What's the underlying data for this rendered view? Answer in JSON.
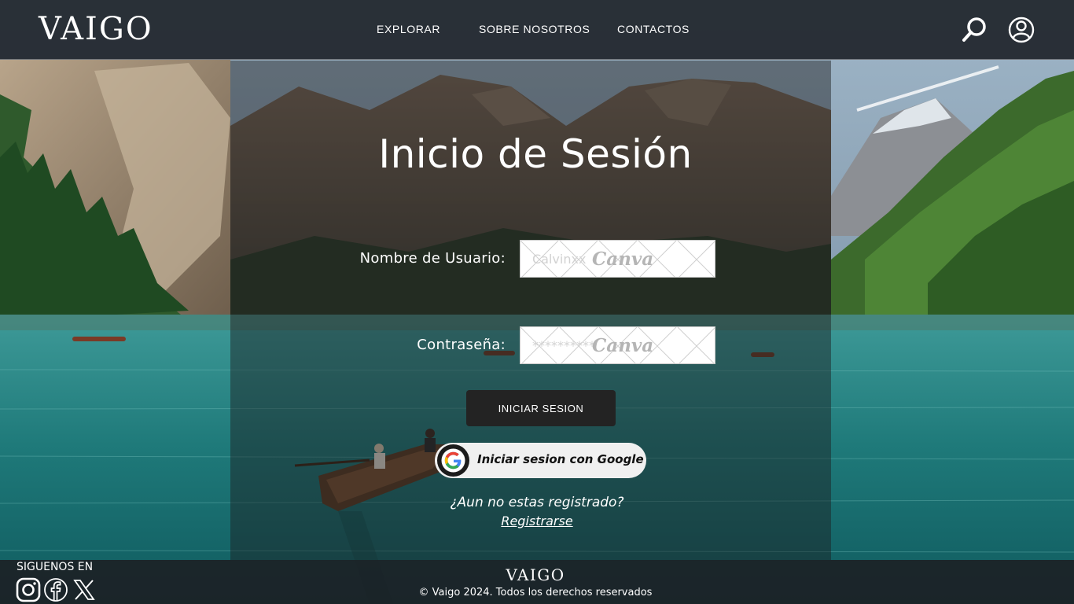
{
  "header": {
    "logo": "VAIGO",
    "nav": [
      {
        "label": "EXPLORAR"
      },
      {
        "label": "SOBRE NOSOTROS"
      },
      {
        "label": "CONTACTOS"
      }
    ],
    "icons": [
      "search-icon",
      "user-account-icon"
    ]
  },
  "login": {
    "title": "Inicio de Sesión",
    "username_label": "Nombre de Usuario:",
    "username_placeholder": "Calvinxx",
    "password_label": "Contraseña:",
    "password_placeholder": "**********",
    "field_watermark": "Canva",
    "submit_label": "INICIAR SESION",
    "google_label": "Iniciar sesion con Google",
    "register_prompt": "¿Aun no estas registrado?",
    "register_link": "Registrarse"
  },
  "footer": {
    "follow_label": "SIGUENOS EN",
    "social": [
      "instagram-icon",
      "facebook-icon",
      "x-icon"
    ],
    "logo": "VAIGO",
    "copyright": "© Vaigo 2024. Todos los derechos reservados"
  },
  "colors": {
    "header_bg": "#161a20",
    "panel_overlay": "#1c1c1e",
    "button_dark": "#232323",
    "google_button": "#f0f0f0",
    "water": "#1f7a7a"
  }
}
